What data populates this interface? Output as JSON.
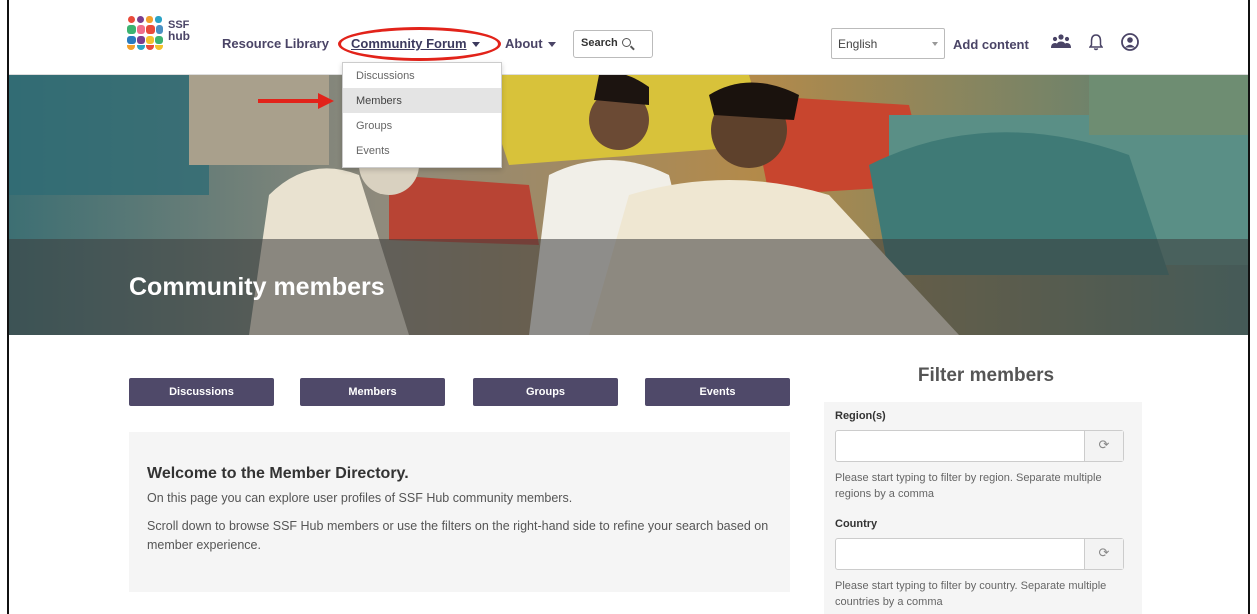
{
  "logo": {
    "line1": "SSF",
    "line2": "hub"
  },
  "nav": {
    "resource_library": "Resource Library",
    "community_forum": "Community Forum",
    "about": "About",
    "search_label": "Search",
    "language": "English",
    "add_content": "Add content"
  },
  "dropdown": {
    "items": [
      "Discussions",
      "Members",
      "Groups",
      "Events"
    ],
    "active_index": 1
  },
  "hero": {
    "title": "Community members"
  },
  "tabs": [
    "Discussions",
    "Members",
    "Groups",
    "Events"
  ],
  "welcome": {
    "heading": "Welcome to the Member Directory.",
    "para1": "On this page you can explore user profiles of SSF Hub community members.",
    "para2": "Scroll down to browse SSF Hub members or use the filters on the right-hand side to refine your search based on member experience."
  },
  "filter": {
    "title": "Filter members",
    "region_label": "Region(s)",
    "region_help": "Please start typing to filter by region. Separate multiple regions by a comma",
    "country_label": "Country",
    "country_help": "Please start typing to filter by country. Separate multiple countries by a comma"
  },
  "colors": {
    "brand_purple": "#4f4969",
    "annotation_red": "#e2231a"
  },
  "icons": [
    "people-icon",
    "bell-icon",
    "user-icon",
    "search-icon",
    "refresh-icon",
    "chevron-down-icon"
  ]
}
